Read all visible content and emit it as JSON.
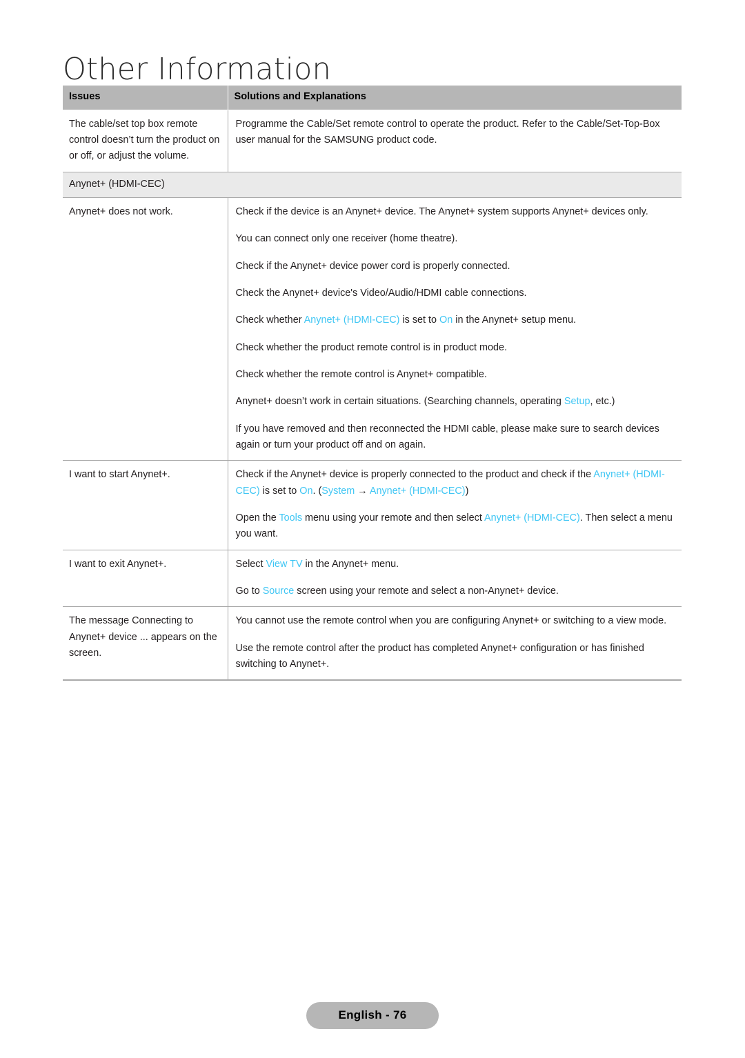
{
  "page": {
    "title": "Other Information",
    "footer_badge": "English - 76",
    "accent_color": "#3fc6f4",
    "header_bg": "#b6b6b6",
    "section_bg": "#eaeaea"
  },
  "table": {
    "headers": {
      "issues": "Issues",
      "solutions": "Solutions and Explanations"
    },
    "rows": [
      {
        "type": "data",
        "issue": "The cable/set top box remote control doesn’t turn the product on or off, or adjust the volume.",
        "solutions": [
          "Programme the Cable/Set remote control to operate the product. Refer to the Cable/Set-Top-Box user manual for the SAMSUNG product code."
        ]
      },
      {
        "type": "section",
        "label": "Anynet+ (HDMI-CEC)"
      },
      {
        "type": "data",
        "issue": "Anynet+ does not work.",
        "solutions": [
          "Check if the device is an Anynet+ device. The Anynet+ system supports Anynet+ devices only.",
          "You can connect only one receiver (home theatre).",
          "Check if the Anynet+ device power cord is properly connected.",
          "Check the Anynet+ device's Video/Audio/HDMI cable connections.",
          "Check whether Anynet+ (HDMI-CEC) is set to On in the Anynet+ setup menu.",
          "Check whether the product remote control is in product mode.",
          "Check whether the remote control is Anynet+ compatible.",
          "Anynet+ doesn’t work in certain situations. (Searching channels, operating Setup, etc.)",
          "If you have removed and then reconnected the HDMI cable, please make sure to search devices again or turn your product off and on again."
        ],
        "solutions_rich": [
          [
            {
              "t": "Check if the device is an Anynet+ device. The Anynet+ system supports Anynet+ devices only.",
              "c": "n"
            }
          ],
          [
            {
              "t": "You can connect only one receiver (home theatre).",
              "c": "n"
            }
          ],
          [
            {
              "t": "Check if the Anynet+ device power cord is properly connected.",
              "c": "n"
            }
          ],
          [
            {
              "t": "Check the Anynet+ device's Video/Audio/HDMI cable connections.",
              "c": "n"
            }
          ],
          [
            {
              "t": "Check whether ",
              "c": "n"
            },
            {
              "t": "Anynet+ (HDMI-CEC)",
              "c": "h"
            },
            {
              "t": " is set to ",
              "c": "n"
            },
            {
              "t": "On",
              "c": "h"
            },
            {
              "t": " in the Anynet+ setup menu.",
              "c": "n"
            }
          ],
          [
            {
              "t": "Check whether the product remote control is in product mode.",
              "c": "n"
            }
          ],
          [
            {
              "t": "Check whether the remote control is Anynet+ compatible.",
              "c": "n"
            }
          ],
          [
            {
              "t": "Anynet+ doesn’t work in certain situations. (Searching channels, operating ",
              "c": "n"
            },
            {
              "t": "Setup",
              "c": "h"
            },
            {
              "t": ", etc.)",
              "c": "n"
            }
          ],
          [
            {
              "t": "If you have removed and then reconnected the HDMI cable, please make sure to search devices again or turn your product off and on again.",
              "c": "n"
            }
          ]
        ]
      },
      {
        "type": "data",
        "issue": "I want to start Anynet+.",
        "solutions_rich": [
          [
            {
              "t": "Check if the Anynet+ device is properly connected to the product and check if the ",
              "c": "n"
            },
            {
              "t": "Anynet+ (HDMI-CEC)",
              "c": "h"
            },
            {
              "t": " is set to ",
              "c": "n"
            },
            {
              "t": "On",
              "c": "h"
            },
            {
              "t": ". (",
              "c": "n"
            },
            {
              "t": "System",
              "c": "h"
            },
            {
              "t": " → ",
              "c": "n"
            },
            {
              "t": "Anynet+ (HDMI-CEC)",
              "c": "h"
            },
            {
              "t": ")",
              "c": "n"
            }
          ],
          [
            {
              "t": "Open the ",
              "c": "n"
            },
            {
              "t": "Tools",
              "c": "h"
            },
            {
              "t": " menu using your remote and then select ",
              "c": "n"
            },
            {
              "t": "Anynet+ (HDMI-CEC)",
              "c": "h"
            },
            {
              "t": ". Then select a menu you want.",
              "c": "n"
            }
          ]
        ]
      },
      {
        "type": "data",
        "issue": "I want to exit Anynet+.",
        "solutions_rich": [
          [
            {
              "t": "Select ",
              "c": "n"
            },
            {
              "t": "View TV",
              "c": "h"
            },
            {
              "t": " in the Anynet+ menu.",
              "c": "n"
            }
          ],
          [
            {
              "t": "Go to ",
              "c": "n"
            },
            {
              "t": "Source",
              "c": "h"
            },
            {
              "t": " screen using your remote and select a non-Anynet+ device.",
              "c": "n"
            }
          ]
        ]
      },
      {
        "type": "data",
        "issue": "The message Connecting to Anynet+ device ... appears on the screen.",
        "solutions_rich": [
          [
            {
              "t": "You cannot use the remote control when you are configuring Anynet+ or switching to a view mode.",
              "c": "n"
            }
          ],
          [
            {
              "t": "Use the remote control after the product has completed Anynet+ configuration or has finished switching to Anynet+.",
              "c": "n"
            }
          ]
        ]
      }
    ]
  }
}
